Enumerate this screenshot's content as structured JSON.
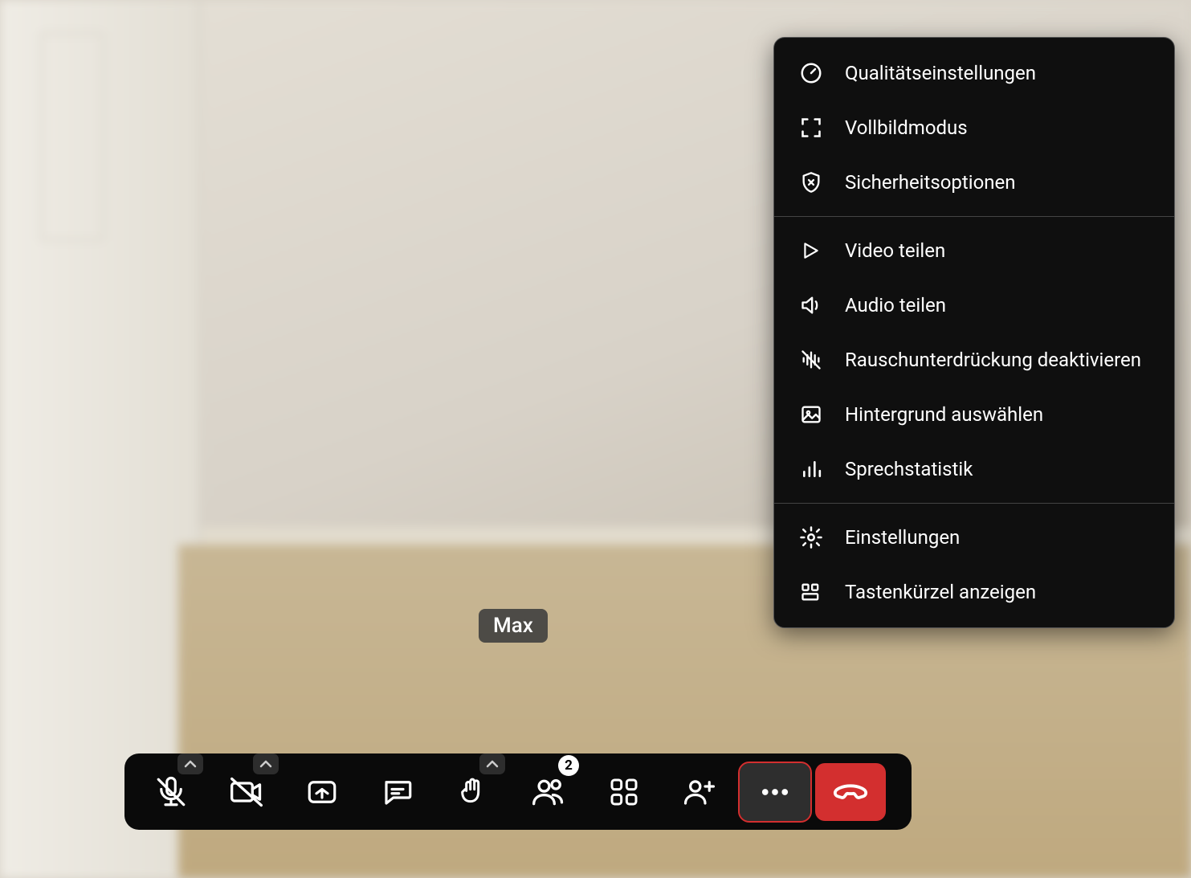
{
  "participant": {
    "name": "Max"
  },
  "menu": {
    "items": [
      {
        "label": "Qualitätseinstellungen",
        "icon": "gauge"
      },
      {
        "label": "Vollbildmodus",
        "icon": "fullscreen"
      },
      {
        "label": "Sicherheitsoptionen",
        "icon": "shield-x"
      },
      {
        "label": "Video teilen",
        "icon": "play"
      },
      {
        "label": "Audio teilen",
        "icon": "speaker"
      },
      {
        "label": "Rauschunterdrückung deaktivieren",
        "icon": "audio-off"
      },
      {
        "label": "Hintergrund auswählen",
        "icon": "image"
      },
      {
        "label": "Sprechstatistik",
        "icon": "bar-chart"
      },
      {
        "label": "Einstellungen",
        "icon": "gear"
      },
      {
        "label": "Tastenkürzel anzeigen",
        "icon": "shortcuts"
      }
    ]
  },
  "toolbar": {
    "participants_badge": "2"
  }
}
